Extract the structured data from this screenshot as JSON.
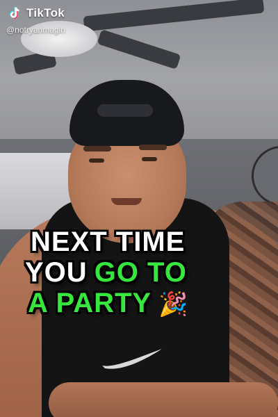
{
  "app": {
    "brand_name": "TikTok",
    "handle": "@notryanmagin",
    "accent_color": "#36e83d",
    "icons": [
      "tiktok-logo-icon",
      "party-popper-emoji"
    ]
  },
  "caption": {
    "line1": "NEXT TIME",
    "line2_white": "YOU",
    "line2_green": "GO TO",
    "line3_green": "A PARTY",
    "emoji": "🎉"
  }
}
